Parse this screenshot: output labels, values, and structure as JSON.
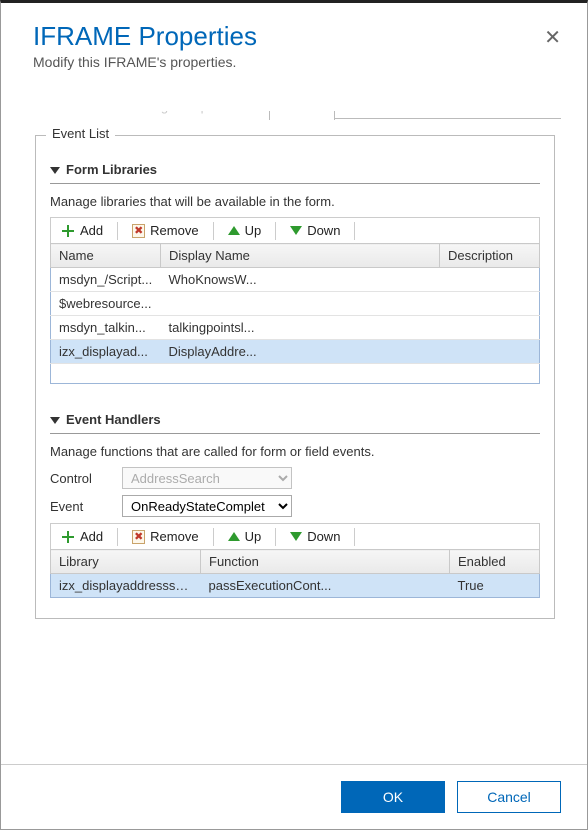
{
  "header": {
    "title": "IFRAME Properties",
    "subtitle": "Modify this IFRAME's properties."
  },
  "tabs": {
    "general": "General",
    "formatting": "Formatting",
    "dependencies": "Dependencies",
    "events": "Events"
  },
  "fieldset_legend": "Event List",
  "form_libraries": {
    "heading": "Form Libraries",
    "hint": "Manage libraries that will be available in the form.",
    "toolbar": {
      "add": "Add",
      "remove": "Remove",
      "up": "Up",
      "down": "Down"
    },
    "columns": {
      "name": "Name",
      "display": "Display Name",
      "desc": "Description"
    },
    "rows": [
      {
        "name": "msdyn_/Script...",
        "display": "WhoKnowsW...",
        "desc": ""
      },
      {
        "name": "$webresource...",
        "display": "",
        "desc": ""
      },
      {
        "name": "msdyn_talkin...",
        "display": "talkingpointsl...",
        "desc": ""
      },
      {
        "name": "izx_displayad...",
        "display": "DisplayAddre...",
        "desc": ""
      }
    ],
    "selected_index": 3
  },
  "event_handlers": {
    "heading": "Event Handlers",
    "hint": "Manage functions that are called for form or field events.",
    "control_label": "Control",
    "control_value": "AddressSearch",
    "event_label": "Event",
    "event_value": "OnReadyStateComplet",
    "toolbar": {
      "add": "Add",
      "remove": "Remove",
      "up": "Up",
      "down": "Down"
    },
    "columns": {
      "lib": "Library",
      "func": "Function",
      "enabled": "Enabled"
    },
    "rows": [
      {
        "lib": "izx_displayaddresssd...",
        "func": "passExecutionCont...",
        "enabled": "True"
      }
    ],
    "selected_index": 0
  },
  "footer": {
    "ok": "OK",
    "cancel": "Cancel"
  }
}
